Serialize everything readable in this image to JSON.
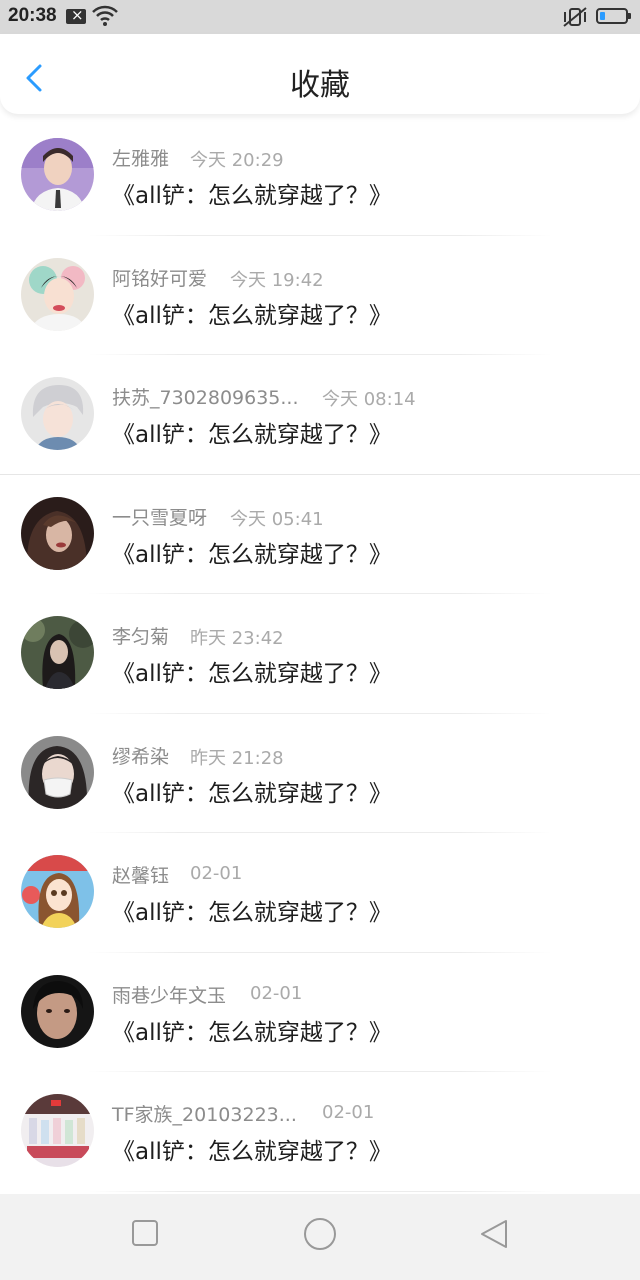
{
  "status_bar": {
    "time": "20:38",
    "icons": [
      "sim-off-icon",
      "wifi-icon",
      "mute-vibrate-icon",
      "battery-icon"
    ],
    "battery_color": "#2b9cff"
  },
  "header": {
    "title": "收藏",
    "back_icon": "chevron-left-icon",
    "accent_color": "#2b9cff"
  },
  "favorites": [
    {
      "user": "左雅雅",
      "time": "今天 20:29",
      "title": "《all铲：怎么就穿越了？》"
    },
    {
      "user": "阿铭好可爱",
      "time": "今天 19:42",
      "title": "《all铲：怎么就穿越了？》"
    },
    {
      "user": "扶苏_7302809635...",
      "time": "今天 08:14",
      "title": "《all铲：怎么就穿越了？》"
    },
    {
      "user": "一只雪夏呀",
      "time": "今天 05:41",
      "title": "《all铲：怎么就穿越了？》"
    },
    {
      "user": "李匀菊",
      "time": "昨天 23:42",
      "title": "《all铲：怎么就穿越了？》"
    },
    {
      "user": "缪希染",
      "time": "昨天 21:28",
      "title": "《all铲：怎么就穿越了？》"
    },
    {
      "user": "赵馨钰",
      "time": "02-01",
      "title": "《all铲：怎么就穿越了？》"
    },
    {
      "user": "雨巷少年文玉",
      "time": "02-01",
      "title": "《all铲：怎么就穿越了？》"
    },
    {
      "user": "TF家族_20103223...",
      "time": "02-01",
      "title": "《all铲：怎么就穿越了？》"
    }
  ],
  "nav_bar": {
    "icons": [
      "recent-apps-icon",
      "home-icon",
      "back-triangle-icon"
    ]
  }
}
